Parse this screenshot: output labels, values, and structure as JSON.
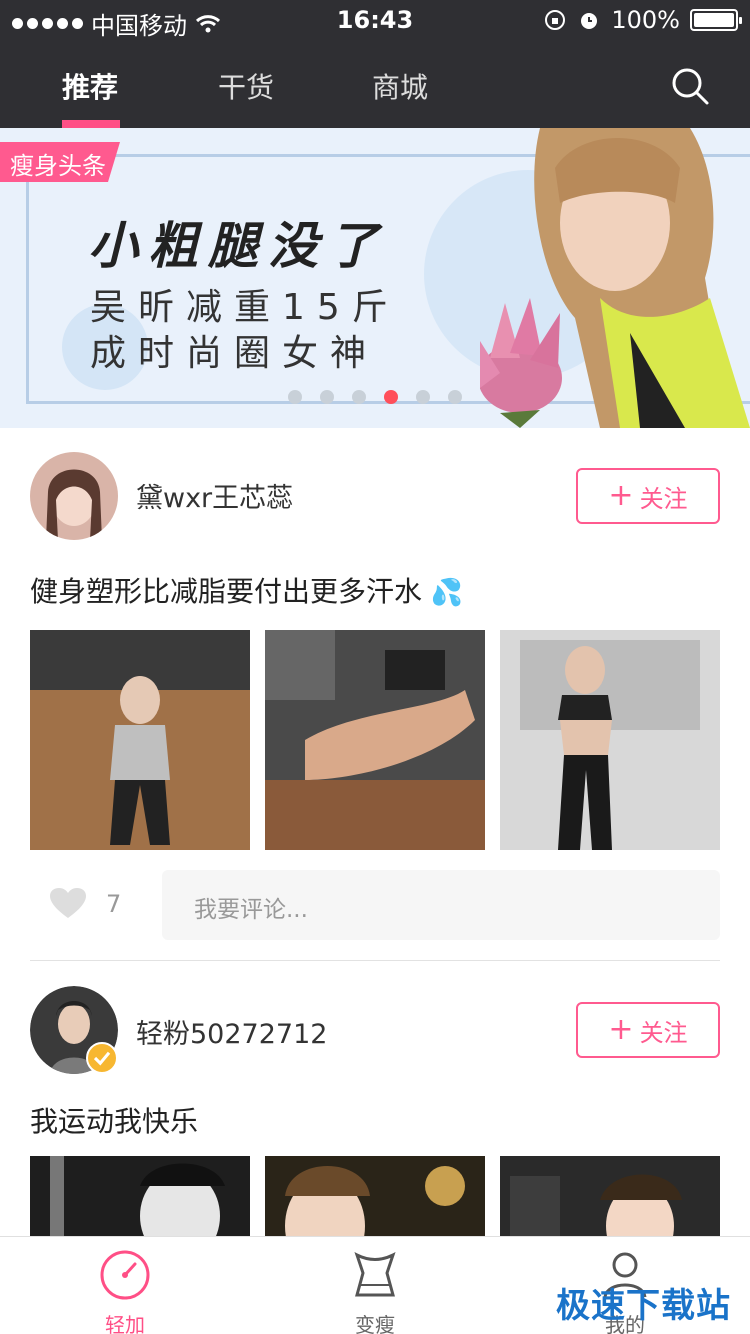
{
  "status": {
    "carrier": "中国移动",
    "time": "16:43",
    "battery": "100%"
  },
  "tabs": [
    {
      "label": "推荐"
    },
    {
      "label": "干货"
    },
    {
      "label": "商城"
    }
  ],
  "banner": {
    "badge": "瘦身头条",
    "headline": "小粗腿没了",
    "sub_line1": "吴昕减重15斤",
    "sub_line2": "成时尚圈女神",
    "pages_total": 6,
    "page_active": 4
  },
  "posts": [
    {
      "username": "黛wxr王芯蕊",
      "follow_label": "关注",
      "text": "健身塑形比减脂要付出更多汗水",
      "likes": "7",
      "comment_placeholder": "我要评论..."
    },
    {
      "username": "轻粉50272712",
      "follow_label": "关注",
      "text": "我运动我快乐"
    }
  ],
  "nav": [
    {
      "label": "轻加"
    },
    {
      "label": "变瘦"
    },
    {
      "label": "我的"
    }
  ],
  "watermark": "极速下载站",
  "colors": {
    "accent": "#ff4f86",
    "header_bg": "#2f2f33"
  }
}
